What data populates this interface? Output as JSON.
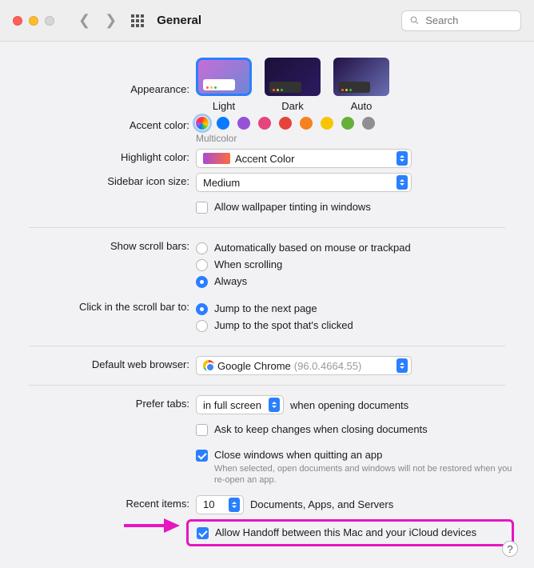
{
  "window": {
    "title": "General",
    "search_placeholder": "Search"
  },
  "appearance": {
    "label": "Appearance:",
    "options": {
      "light": "Light",
      "dark": "Dark",
      "auto": "Auto"
    }
  },
  "accent": {
    "label": "Accent color:",
    "caption": "Multicolor",
    "colors": [
      "multicolor",
      "#0a7aff",
      "#9751d6",
      "#e6447f",
      "#e6443a",
      "#f6811f",
      "#f7c600",
      "#66b03a",
      "#8e8e93"
    ]
  },
  "highlight": {
    "label": "Highlight color:",
    "value": "Accent Color"
  },
  "sidebar": {
    "label": "Sidebar icon size:",
    "value": "Medium"
  },
  "wallpaper_tint": {
    "label": "Allow wallpaper tinting in windows",
    "checked": false
  },
  "scrollbars": {
    "label": "Show scroll bars:",
    "options": {
      "auto": "Automatically based on mouse or trackpad",
      "scrolling": "When scrolling",
      "always": "Always"
    },
    "selected": "always"
  },
  "scrollbar_click": {
    "label": "Click in the scroll bar to:",
    "options": {
      "jump_next": "Jump to the next page",
      "jump_spot": "Jump to the spot that's clicked"
    },
    "selected": "jump_next"
  },
  "browser": {
    "label": "Default web browser:",
    "name": "Google Chrome",
    "version": "(96.0.4664.55)"
  },
  "tabs": {
    "label": "Prefer tabs:",
    "value": "in full screen",
    "suffix": "when opening documents"
  },
  "ask_keep": {
    "label": "Ask to keep changes when closing documents",
    "checked": false
  },
  "close_windows": {
    "label": "Close windows when quitting an app",
    "hint": "When selected, open documents and windows will not be restored when you re-open an app.",
    "checked": true
  },
  "recent": {
    "label": "Recent items:",
    "value": "10",
    "suffix": "Documents, Apps, and Servers"
  },
  "handoff": {
    "label": "Allow Handoff between this Mac and your iCloud devices",
    "checked": true
  }
}
